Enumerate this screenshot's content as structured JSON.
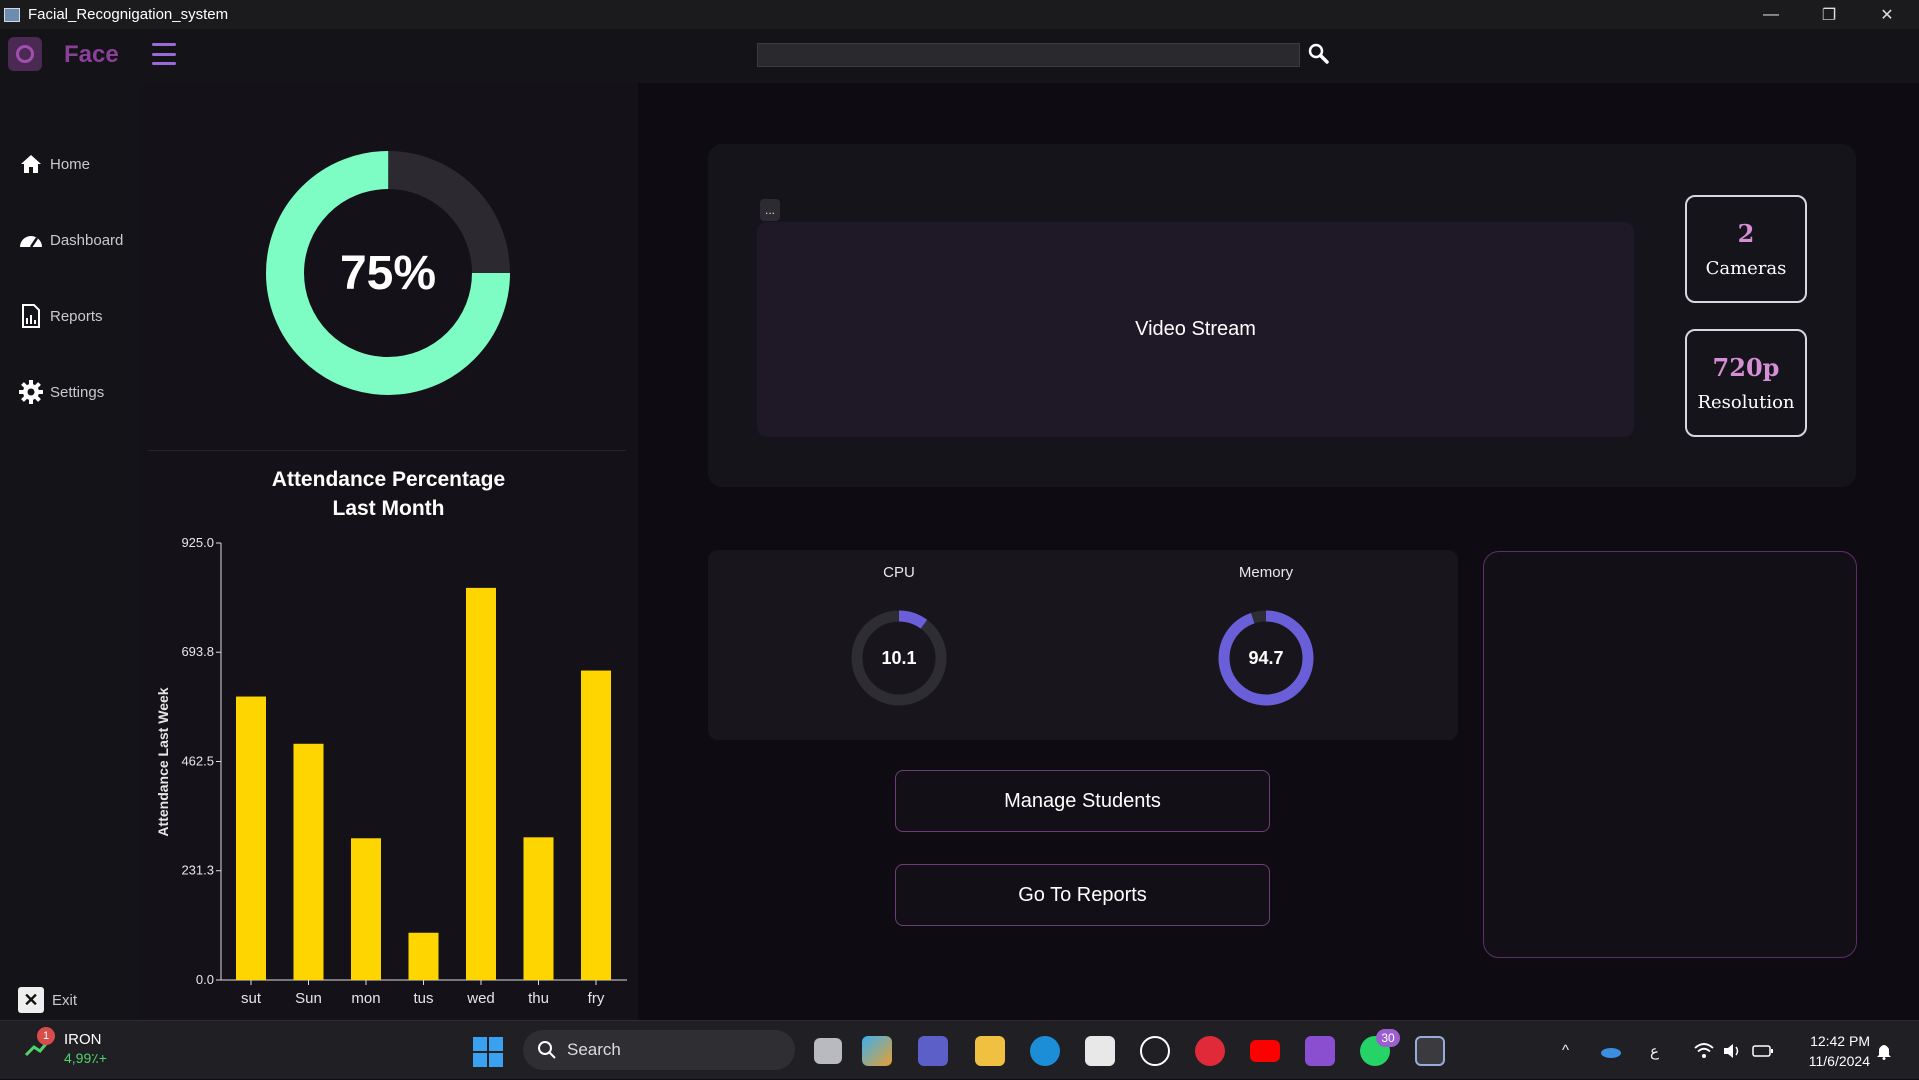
{
  "window": {
    "title": "Facial_Recognigation_system",
    "minimize": "—",
    "restore": "❐",
    "close": "✕"
  },
  "header": {
    "brand": "Face",
    "search_value": "",
    "search_icon": "search-icon"
  },
  "sidebar": {
    "items": [
      {
        "label": "Home",
        "icon": "home-icon"
      },
      {
        "label": "Dashboard",
        "icon": "dashboard-icon"
      },
      {
        "label": "Reports",
        "icon": "reports-icon"
      },
      {
        "label": "Settings",
        "icon": "gear-icon"
      }
    ],
    "exit_label": "Exit"
  },
  "attendance": {
    "percent_text": "75%",
    "percent_value": 75,
    "ring_color": "#7dfcc4",
    "track_color": "#2c2a30"
  },
  "chart_data": {
    "type": "bar",
    "title": "Attendance Percentage\nLast Month",
    "title_lines": [
      "Attendance Percentage",
      "Last Month"
    ],
    "ylabel": "Attendance Last Week",
    "xlabel": "",
    "categories": [
      "sut",
      "Sun",
      "mon",
      "tus",
      "wed",
      "thu",
      "fry"
    ],
    "values": [
      600,
      500,
      300,
      100,
      830,
      302,
      655
    ],
    "ylim": [
      0,
      925
    ],
    "yticks": [
      "0.0",
      "231.3",
      "462.5",
      "693.8",
      "925.0"
    ],
    "ytick_values": [
      0,
      231.3,
      462.5,
      693.8,
      925.0
    ],
    "bar_color": "#ffd500",
    "grid": false
  },
  "video": {
    "label": "Video Stream",
    "menu_label": "..."
  },
  "stats": [
    {
      "value": "2",
      "label": "Cameras"
    },
    {
      "value": "720p",
      "label": "Resolution"
    }
  ],
  "system": {
    "cpu": {
      "label": "CPU",
      "value_text": "10.1",
      "value": 10.1
    },
    "memory": {
      "label": "Memory",
      "value_text": "94.7",
      "value": 94.7
    },
    "gauge_color": "#6a5fd8",
    "gauge_track": "#2e2d33"
  },
  "buttons": {
    "manage_students": "Manage Students",
    "go_to_reports": "Go To Reports"
  },
  "taskbar": {
    "stock_name": "IRON",
    "stock_change": "4,99٪+",
    "stock_badge": "1",
    "search_label": "Search",
    "whatsapp_badge": "30",
    "lang": "ع",
    "time": "12:42 PM",
    "date": "11/6/2024"
  }
}
